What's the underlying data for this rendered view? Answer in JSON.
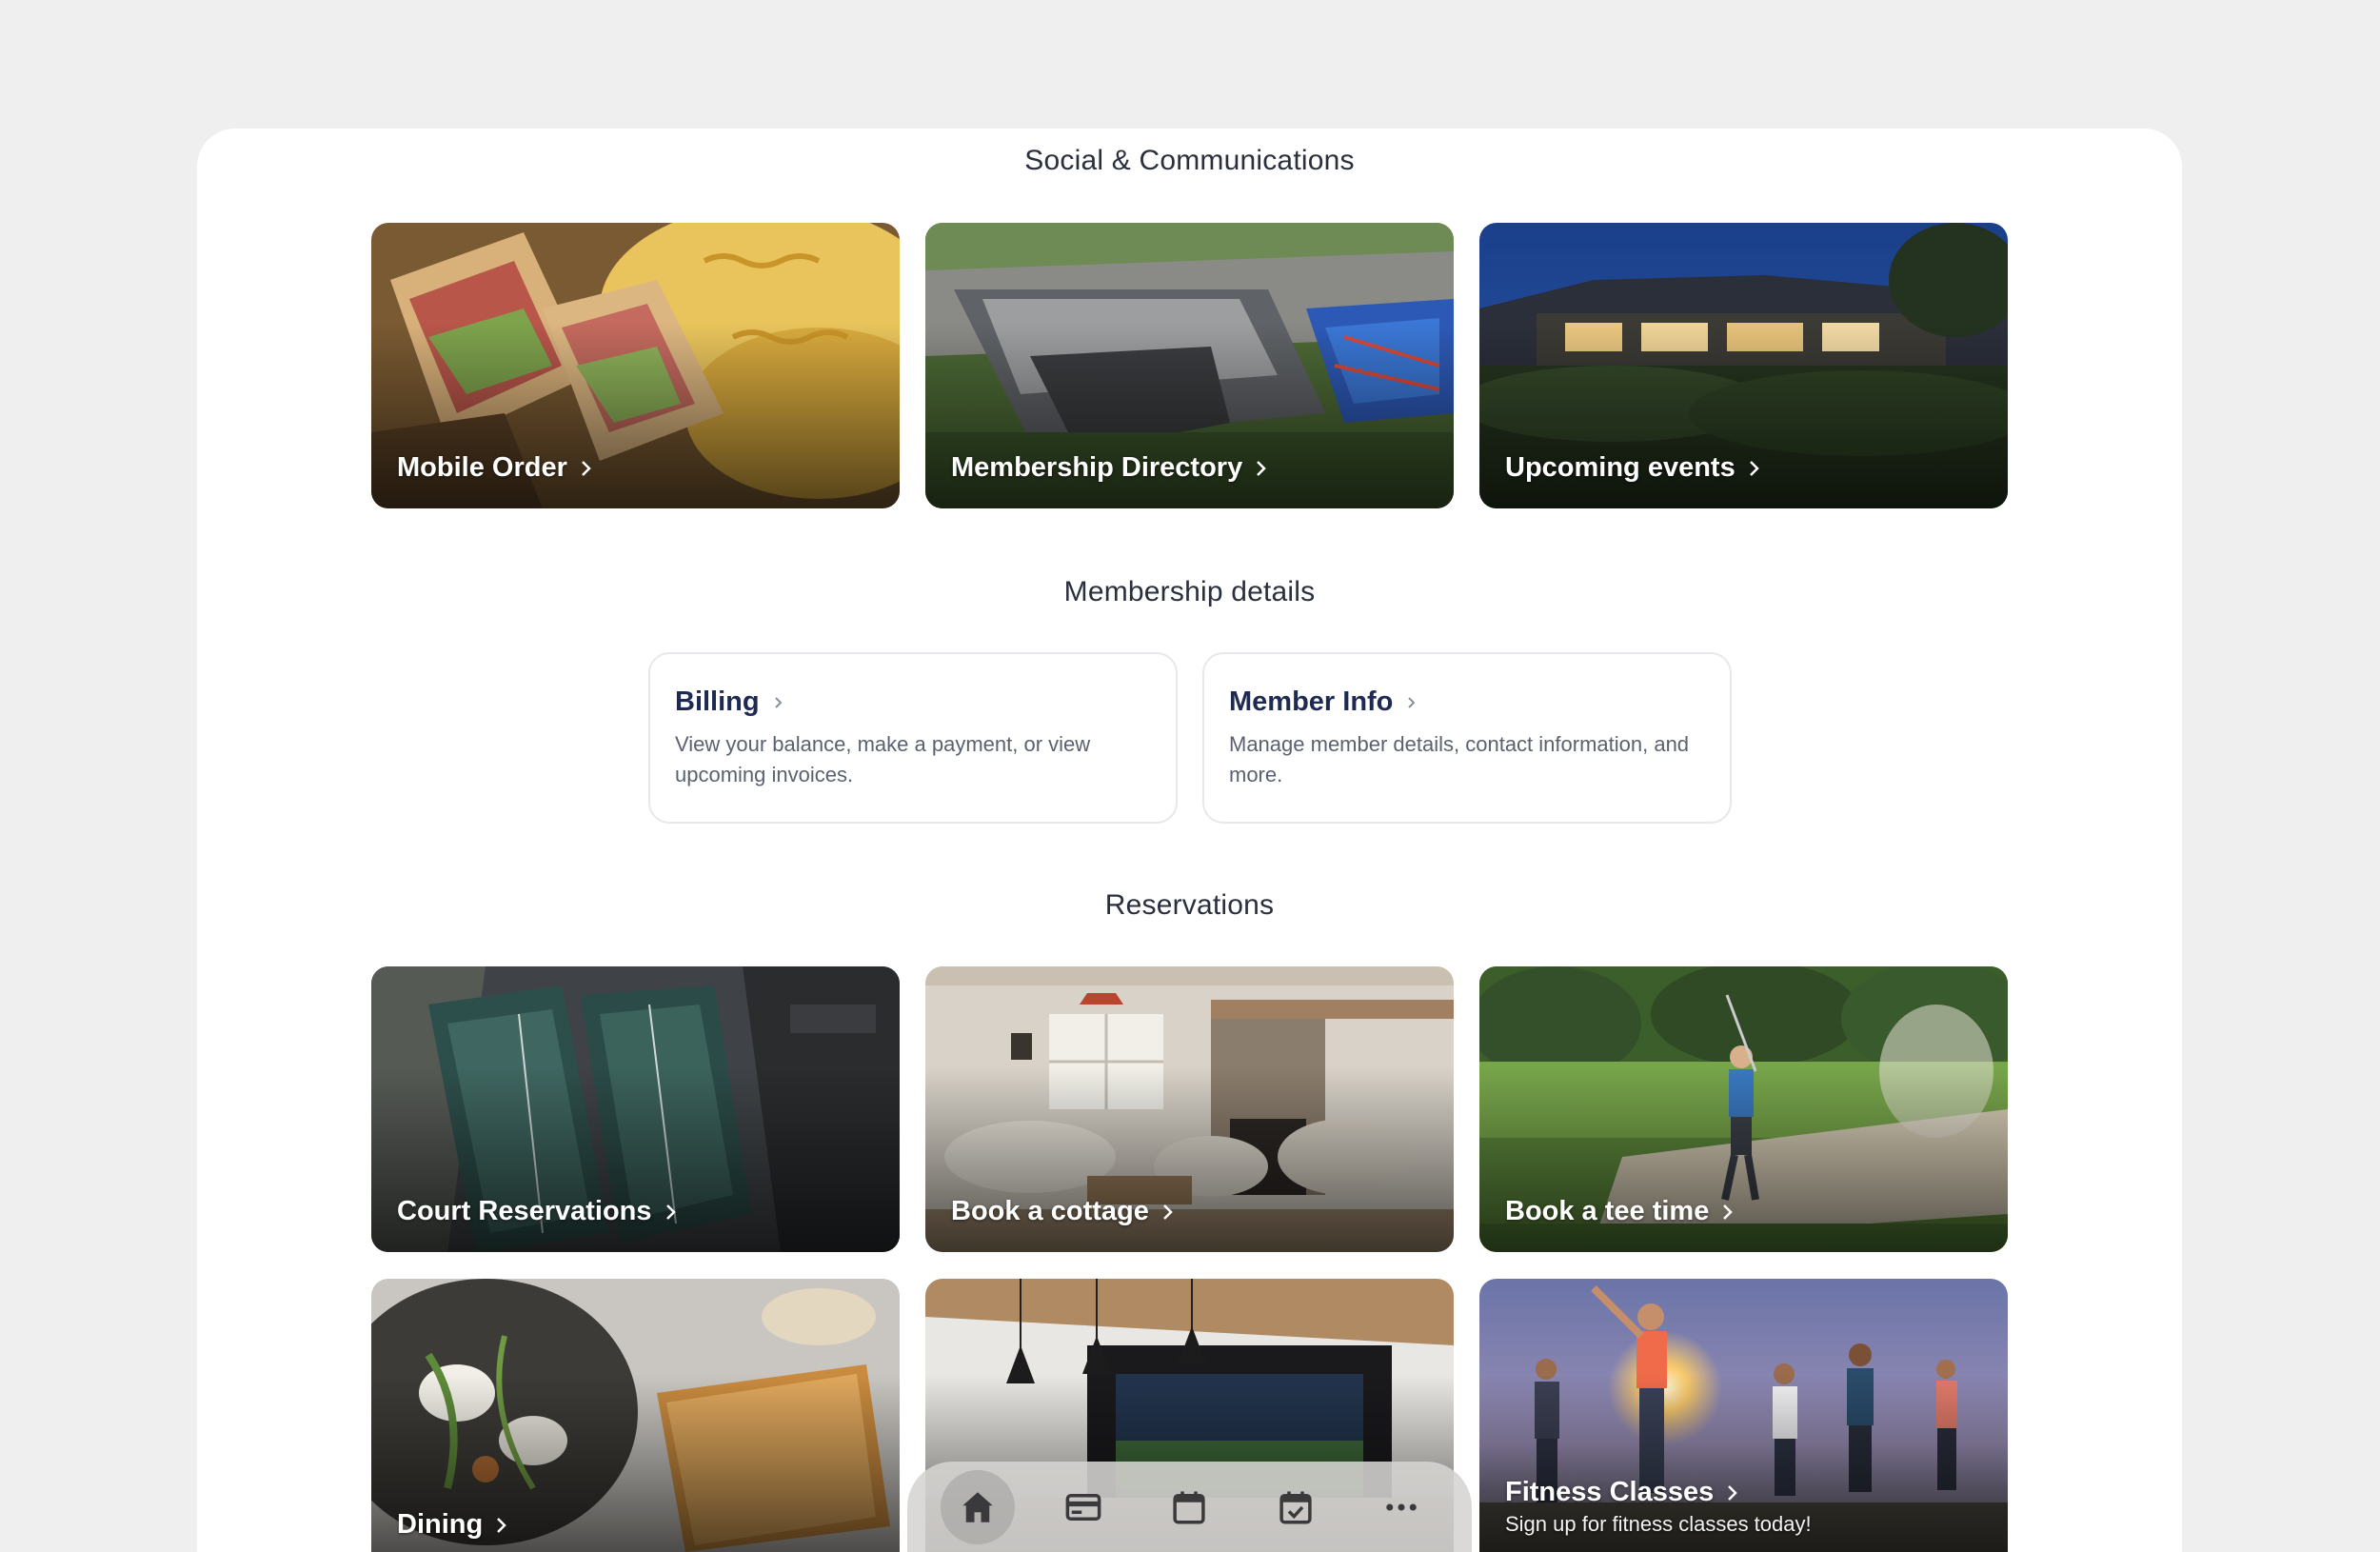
{
  "sections": {
    "social": "Social & Communications",
    "membership": "Membership details",
    "reservations": "Reservations"
  },
  "social_tiles": [
    {
      "label": "Mobile Order",
      "image": "club sandwich with chips"
    },
    {
      "label": "Membership Directory",
      "image": "aerial view of clubhouse and courts"
    },
    {
      "label": "Upcoming events",
      "image": "clubhouse at dusk"
    }
  ],
  "membership_cards": [
    {
      "title": "Billing",
      "desc": "View your balance, make a payment, or view upcoming invoices."
    },
    {
      "title": "Member Info",
      "desc": "Manage member details, contact information, and more."
    }
  ],
  "reservation_tiles": [
    {
      "label": "Court Reservations",
      "image": "aerial view of tennis courts"
    },
    {
      "label": "Book a cottage",
      "image": "cozy cottage living room"
    },
    {
      "label": "Book a tee time",
      "image": "golfer swinging from bunker"
    },
    {
      "label": "Dining",
      "image": "plated fish dish"
    },
    {
      "label": "",
      "image": "golf simulator lounge"
    },
    {
      "label": "Fitness Classes",
      "subtitle": "Sign up for fitness classes today!",
      "image": "outdoor group stretching class"
    }
  ],
  "dock": {
    "items": [
      "home-icon",
      "card-icon",
      "calendar-icon",
      "calendar-check-icon",
      "more-icon"
    ],
    "active": "home-icon"
  },
  "colors": {
    "background": "#efeff0",
    "panel": "#ffffff",
    "card_title": "#1e2a52",
    "card_desc": "#5c6170"
  }
}
